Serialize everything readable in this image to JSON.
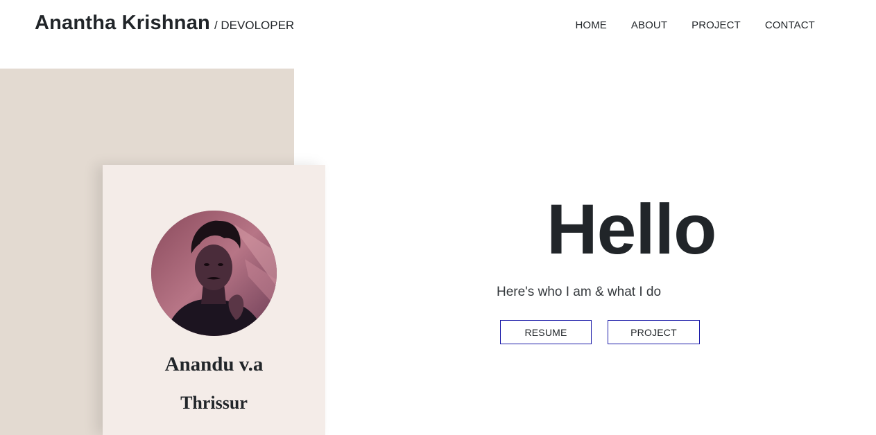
{
  "header": {
    "brand_name": "Anantha Krishnan",
    "brand_role": "/ DEVOLOPER",
    "nav": [
      {
        "label": "HOME"
      },
      {
        "label": "ABOUT"
      },
      {
        "label": "PROJECT"
      },
      {
        "label": "CONTACT"
      }
    ]
  },
  "profile": {
    "name": "Anandu v.a",
    "city": "Thrissur"
  },
  "hero": {
    "title": "Hello",
    "subtitle": "Here's who I am & what I do",
    "buttons": {
      "resume": "RESUME",
      "project": "PROJECT"
    }
  },
  "colors": {
    "background_block": "#e3dad1",
    "card": "#f4ece8",
    "button_border": "#1a1aa8",
    "text": "#212529"
  }
}
